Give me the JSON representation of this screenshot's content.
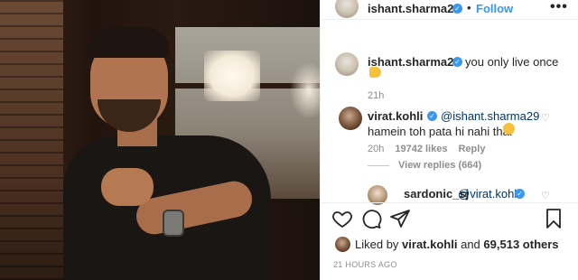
{
  "post": {
    "username": "ishant.sharma29",
    "follow_label": "Follow",
    "dot": "•",
    "more_label": "•••",
    "caption": "you only live once",
    "caption_time": "21h",
    "likes_prefix": "Liked by",
    "likes_user": "virat.kohli",
    "likes_and": "and",
    "likes_count": "69,513 others",
    "post_time": "21 HOURS AGO"
  },
  "comments": [
    {
      "username": "virat.kohli",
      "mention": "@ishant.sharma29",
      "text": "hamein toh pata hi nahi tha.",
      "time": "20h",
      "likes": "19742 likes",
      "reply_label": "Reply",
      "view_replies": "View replies (664)"
    },
    {
      "username": "sardonic_sj",
      "mention": "@virat.kohli"
    }
  ],
  "icons": {
    "verified": "✓",
    "heart": "♡",
    "like": "heart-icon",
    "comment": "comment-icon",
    "share": "share-icon",
    "save": "bookmark-icon"
  },
  "colors": {
    "link_blue": "#3897f0",
    "mention_blue": "#003569",
    "muted": "#8e8e8e"
  }
}
